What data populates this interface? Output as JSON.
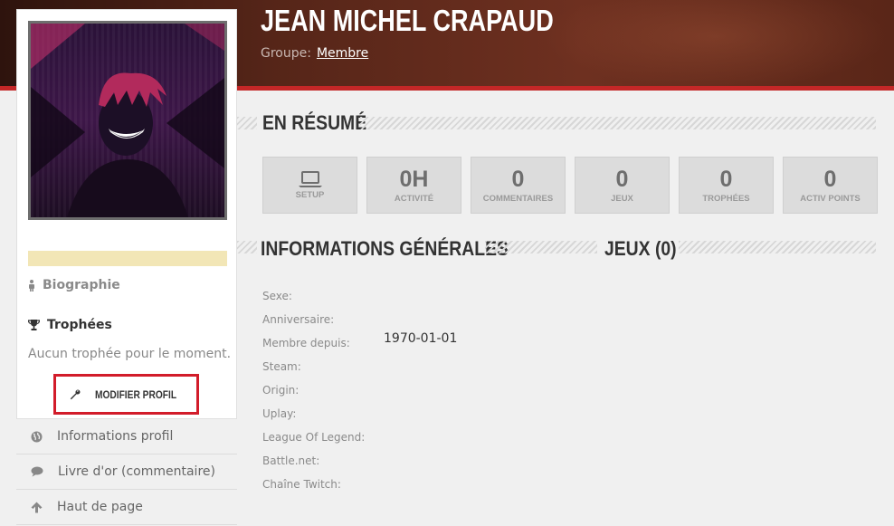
{
  "header": {
    "name": "JEAN MICHEL CRAPAUD",
    "group_label": "Groupe:",
    "group_value": "Membre"
  },
  "profile": {
    "bio_label": "Biographie",
    "trophies_label": "Trophées",
    "trophies_empty": "Aucun trophée pour le moment.",
    "edit_button": "MODIFIER PROFIL",
    "level_progress": 0,
    "level_bar_color": "#f2e6b6"
  },
  "nav": {
    "items": [
      {
        "label": "Informations profil",
        "icon": "globe-icon"
      },
      {
        "label": "Livre d'or (commentaire)",
        "icon": "speech-bubble-icon"
      },
      {
        "label": "Haut de page",
        "icon": "arrow-up-icon"
      }
    ]
  },
  "summary": {
    "title": "EN RÉSUMÉ",
    "stats": [
      {
        "value": "",
        "label": "SETUP",
        "icon": "laptop-icon"
      },
      {
        "value": "0H",
        "label": "ACTIVITÉ"
      },
      {
        "value": "0",
        "label": "COMMENTAIRES"
      },
      {
        "value": "0",
        "label": "JEUX"
      },
      {
        "value": "0",
        "label": "TROPHÉES"
      },
      {
        "value": "0",
        "label": "ACTIV POINTS"
      }
    ]
  },
  "general": {
    "title": "INFORMATIONS GÉNÉRALES",
    "rows": [
      {
        "label": "Sexe:",
        "value": ""
      },
      {
        "label": "Anniversaire:",
        "value": ""
      },
      {
        "label": "Membre depuis:",
        "value": "1970-01-01"
      },
      {
        "label": "Steam:",
        "value": ""
      },
      {
        "label": "Origin:",
        "value": ""
      },
      {
        "label": "Uplay:",
        "value": ""
      },
      {
        "label": "League Of Legend:",
        "value": ""
      },
      {
        "label": "Battle.net:",
        "value": ""
      },
      {
        "label": "Chaîne Twitch:",
        "value": ""
      }
    ]
  },
  "games": {
    "title": "JEUX (0)"
  },
  "colors": {
    "accent_red": "#c42727",
    "edit_border": "#d21c2a"
  }
}
